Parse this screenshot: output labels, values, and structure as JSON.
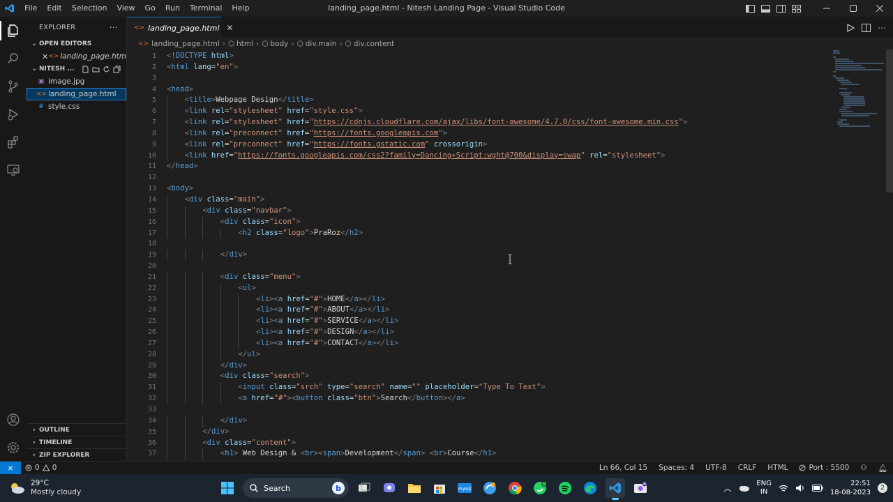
{
  "window": {
    "title": "landing_page.html - Nitesh Landing Page - Visual Studio Code",
    "menu": [
      "File",
      "Edit",
      "Selection",
      "View",
      "Go",
      "Run",
      "Terminal",
      "Help"
    ]
  },
  "sidebar": {
    "title": "EXPLORER",
    "open_editors_label": "OPEN EDITORS",
    "open_editor_file": "landing_page.html",
    "folder_label": "NITESH ...",
    "files": [
      "image.jpg",
      "landing_page.html",
      "style.css"
    ],
    "outline_label": "OUTLINE",
    "timeline_label": "TIMELINE",
    "zip_label": "ZIP EXPLORER"
  },
  "tab": {
    "label": "landing_page.html"
  },
  "breadcrumb": [
    "landing_page.html",
    "html",
    "body",
    "div.main",
    "div.content"
  ],
  "status": {
    "errors": "0",
    "warnings": "0",
    "position": "Ln 66, Col 15",
    "spaces": "Spaces: 4",
    "encoding": "UTF-8",
    "eol": "CRLF",
    "language": "HTML",
    "port": "Port : 5500"
  },
  "taskbar": {
    "temperature": "29°C",
    "condition": "Mostly cloudy",
    "search_label": "Search",
    "lang_top": "ENG",
    "lang_bottom": "IN",
    "time": "22:51",
    "date": "18-08-2023"
  },
  "colors": {
    "accent": "#0078d4",
    "tag": "#569cd6",
    "attr": "#9cdcfe",
    "string": "#ce9178"
  },
  "code": [
    {
      "indent": 0,
      "parts": [
        [
          "br",
          "<"
        ],
        [
          "tg",
          "!DOCTYPE "
        ],
        [
          "at",
          "html"
        ],
        [
          "br",
          ">"
        ]
      ]
    },
    {
      "indent": 0,
      "parts": [
        [
          "br",
          "<"
        ],
        [
          "tg",
          "html "
        ],
        [
          "at",
          "lang"
        ],
        [
          "tx",
          "="
        ],
        [
          "st",
          "\"en\""
        ],
        [
          "br",
          ">"
        ]
      ]
    },
    {
      "indent": 0,
      "parts": []
    },
    {
      "indent": 0,
      "parts": [
        [
          "br",
          "<"
        ],
        [
          "tg",
          "head"
        ],
        [
          "br",
          ">"
        ]
      ]
    },
    {
      "indent": 1,
      "parts": [
        [
          "br",
          "<"
        ],
        [
          "tg",
          "title"
        ],
        [
          "br",
          ">"
        ],
        [
          "tx",
          "Webpage Design"
        ],
        [
          "br",
          "</"
        ],
        [
          "tg",
          "title"
        ],
        [
          "br",
          ">"
        ]
      ]
    },
    {
      "indent": 1,
      "parts": [
        [
          "br",
          "<"
        ],
        [
          "tg",
          "link "
        ],
        [
          "at",
          "rel"
        ],
        [
          "tx",
          "="
        ],
        [
          "st",
          "\"stylesheet\" "
        ],
        [
          "at",
          "href"
        ],
        [
          "tx",
          "="
        ],
        [
          "st",
          "\"style.css\""
        ],
        [
          "br",
          ">"
        ]
      ]
    },
    {
      "indent": 1,
      "parts": [
        [
          "br",
          "<"
        ],
        [
          "tg",
          "link "
        ],
        [
          "at",
          "rel"
        ],
        [
          "tx",
          "="
        ],
        [
          "st",
          "\"stylesheet\" "
        ],
        [
          "at",
          "href"
        ],
        [
          "tx",
          "="
        ],
        [
          "st",
          "\""
        ],
        [
          "stl",
          "https://cdnjs.cloudflare.com/ajax/libs/font-awesome/4.7.0/css/font-awesome.min.css"
        ],
        [
          "st",
          "\""
        ],
        [
          "br",
          ">"
        ]
      ]
    },
    {
      "indent": 1,
      "parts": [
        [
          "br",
          "<"
        ],
        [
          "tg",
          "link "
        ],
        [
          "at",
          "rel"
        ],
        [
          "tx",
          "="
        ],
        [
          "st",
          "\"preconnect\" "
        ],
        [
          "at",
          "href"
        ],
        [
          "tx",
          "="
        ],
        [
          "st",
          "\""
        ],
        [
          "stl",
          "https://fonts.googleapis.com"
        ],
        [
          "st",
          "\""
        ],
        [
          "br",
          ">"
        ]
      ]
    },
    {
      "indent": 1,
      "parts": [
        [
          "br",
          "<"
        ],
        [
          "tg",
          "link "
        ],
        [
          "at",
          "rel"
        ],
        [
          "tx",
          "="
        ],
        [
          "st",
          "\"preconnect\" "
        ],
        [
          "at",
          "href"
        ],
        [
          "tx",
          "="
        ],
        [
          "st",
          "\""
        ],
        [
          "stl",
          "https://fonts.gstatic.com"
        ],
        [
          "st",
          "\" "
        ],
        [
          "at",
          "crossorigin"
        ],
        [
          "br",
          ">"
        ]
      ]
    },
    {
      "indent": 1,
      "parts": [
        [
          "br",
          "<"
        ],
        [
          "tg",
          "link "
        ],
        [
          "at",
          "href"
        ],
        [
          "tx",
          "="
        ],
        [
          "st",
          "\""
        ],
        [
          "stl",
          "https://fonts.googleapis.com/css2?family=Dancing+Script:wght@700&display=swap"
        ],
        [
          "st",
          "\" "
        ],
        [
          "at",
          "rel"
        ],
        [
          "tx",
          "="
        ],
        [
          "st",
          "\"stylesheet\""
        ],
        [
          "br",
          ">"
        ]
      ]
    },
    {
      "indent": 0,
      "parts": [
        [
          "br",
          "</"
        ],
        [
          "tg",
          "head"
        ],
        [
          "br",
          ">"
        ]
      ]
    },
    {
      "indent": 0,
      "parts": []
    },
    {
      "indent": 0,
      "parts": [
        [
          "br",
          "<"
        ],
        [
          "tg",
          "body"
        ],
        [
          "br",
          ">"
        ]
      ]
    },
    {
      "indent": 1,
      "parts": [
        [
          "br",
          "<"
        ],
        [
          "tg",
          "div "
        ],
        [
          "at",
          "class"
        ],
        [
          "tx",
          "="
        ],
        [
          "st",
          "\"main\""
        ],
        [
          "br",
          ">"
        ]
      ]
    },
    {
      "indent": 2,
      "parts": [
        [
          "br",
          "<"
        ],
        [
          "tg",
          "div "
        ],
        [
          "at",
          "class"
        ],
        [
          "tx",
          "="
        ],
        [
          "st",
          "\"navbar\""
        ],
        [
          "br",
          ">"
        ]
      ]
    },
    {
      "indent": 3,
      "parts": [
        [
          "br",
          "<"
        ],
        [
          "tg",
          "div "
        ],
        [
          "at",
          "class"
        ],
        [
          "tx",
          "="
        ],
        [
          "st",
          "\"icon\""
        ],
        [
          "br",
          ">"
        ]
      ]
    },
    {
      "indent": 4,
      "parts": [
        [
          "br",
          "<"
        ],
        [
          "tg",
          "h2 "
        ],
        [
          "at",
          "class"
        ],
        [
          "tx",
          "="
        ],
        [
          "st",
          "\"logo\""
        ],
        [
          "br",
          ">"
        ],
        [
          "tx",
          "PraRoz"
        ],
        [
          "br",
          "</"
        ],
        [
          "tg",
          "h2"
        ],
        [
          "br",
          ">"
        ]
      ]
    },
    {
      "indent": 0,
      "parts": []
    },
    {
      "indent": 3,
      "parts": [
        [
          "br",
          "</"
        ],
        [
          "tg",
          "div"
        ],
        [
          "br",
          ">"
        ]
      ]
    },
    {
      "indent": 0,
      "parts": []
    },
    {
      "indent": 3,
      "parts": [
        [
          "br",
          "<"
        ],
        [
          "tg",
          "div "
        ],
        [
          "at",
          "class"
        ],
        [
          "tx",
          "="
        ],
        [
          "st",
          "\"menu\""
        ],
        [
          "br",
          ">"
        ]
      ]
    },
    {
      "indent": 4,
      "parts": [
        [
          "br",
          "<"
        ],
        [
          "tg",
          "ul"
        ],
        [
          "br",
          ">"
        ]
      ]
    },
    {
      "indent": 5,
      "parts": [
        [
          "br",
          "<"
        ],
        [
          "tg",
          "li"
        ],
        [
          "br",
          "><"
        ],
        [
          "tg",
          "a "
        ],
        [
          "at",
          "href"
        ],
        [
          "tx",
          "="
        ],
        [
          "st",
          "\"#\""
        ],
        [
          "br",
          ">"
        ],
        [
          "tx",
          "HOME"
        ],
        [
          "br",
          "</"
        ],
        [
          "tg",
          "a"
        ],
        [
          "br",
          "></"
        ],
        [
          "tg",
          "li"
        ],
        [
          "br",
          ">"
        ]
      ]
    },
    {
      "indent": 5,
      "parts": [
        [
          "br",
          "<"
        ],
        [
          "tg",
          "li"
        ],
        [
          "br",
          "><"
        ],
        [
          "tg",
          "a "
        ],
        [
          "at",
          "href"
        ],
        [
          "tx",
          "="
        ],
        [
          "st",
          "\"#\""
        ],
        [
          "br",
          ">"
        ],
        [
          "tx",
          "ABOUT"
        ],
        [
          "br",
          "</"
        ],
        [
          "tg",
          "a"
        ],
        [
          "br",
          "></"
        ],
        [
          "tg",
          "li"
        ],
        [
          "br",
          ">"
        ]
      ]
    },
    {
      "indent": 5,
      "parts": [
        [
          "br",
          "<"
        ],
        [
          "tg",
          "li"
        ],
        [
          "br",
          "><"
        ],
        [
          "tg",
          "a "
        ],
        [
          "at",
          "href"
        ],
        [
          "tx",
          "="
        ],
        [
          "st",
          "\"#\""
        ],
        [
          "br",
          ">"
        ],
        [
          "tx",
          "SERVICE"
        ],
        [
          "br",
          "</"
        ],
        [
          "tg",
          "a"
        ],
        [
          "br",
          "></"
        ],
        [
          "tg",
          "li"
        ],
        [
          "br",
          ">"
        ]
      ]
    },
    {
      "indent": 5,
      "parts": [
        [
          "br",
          "<"
        ],
        [
          "tg",
          "li"
        ],
        [
          "br",
          "><"
        ],
        [
          "tg",
          "a "
        ],
        [
          "at",
          "href"
        ],
        [
          "tx",
          "="
        ],
        [
          "st",
          "\"#\""
        ],
        [
          "br",
          ">"
        ],
        [
          "tx",
          "DESIGN"
        ],
        [
          "br",
          "</"
        ],
        [
          "tg",
          "a"
        ],
        [
          "br",
          "></"
        ],
        [
          "tg",
          "li"
        ],
        [
          "br",
          ">"
        ]
      ]
    },
    {
      "indent": 5,
      "parts": [
        [
          "br",
          "<"
        ],
        [
          "tg",
          "li"
        ],
        [
          "br",
          "><"
        ],
        [
          "tg",
          "a "
        ],
        [
          "at",
          "href"
        ],
        [
          "tx",
          "="
        ],
        [
          "st",
          "\"#\""
        ],
        [
          "br",
          ">"
        ],
        [
          "tx",
          "CONTACT"
        ],
        [
          "br",
          "</"
        ],
        [
          "tg",
          "a"
        ],
        [
          "br",
          "></"
        ],
        [
          "tg",
          "li"
        ],
        [
          "br",
          ">"
        ]
      ]
    },
    {
      "indent": 4,
      "parts": [
        [
          "br",
          "</"
        ],
        [
          "tg",
          "ul"
        ],
        [
          "br",
          ">"
        ]
      ]
    },
    {
      "indent": 3,
      "parts": [
        [
          "br",
          "</"
        ],
        [
          "tg",
          "div"
        ],
        [
          "br",
          ">"
        ]
      ]
    },
    {
      "indent": 3,
      "parts": [
        [
          "br",
          "<"
        ],
        [
          "tg",
          "div "
        ],
        [
          "at",
          "class"
        ],
        [
          "tx",
          "="
        ],
        [
          "st",
          "\"search\""
        ],
        [
          "br",
          ">"
        ]
      ]
    },
    {
      "indent": 4,
      "parts": [
        [
          "br",
          "<"
        ],
        [
          "tg",
          "input "
        ],
        [
          "at",
          "class"
        ],
        [
          "tx",
          "="
        ],
        [
          "st",
          "\"srch\" "
        ],
        [
          "at",
          "type"
        ],
        [
          "tx",
          "="
        ],
        [
          "st",
          "\"search\" "
        ],
        [
          "at",
          "name"
        ],
        [
          "tx",
          "="
        ],
        [
          "st",
          "\"\" "
        ],
        [
          "at",
          "placeholder"
        ],
        [
          "tx",
          "="
        ],
        [
          "st",
          "\"Type To Text\""
        ],
        [
          "br",
          ">"
        ]
      ]
    },
    {
      "indent": 4,
      "parts": [
        [
          "br",
          "<"
        ],
        [
          "tg",
          "a "
        ],
        [
          "at",
          "href"
        ],
        [
          "tx",
          "="
        ],
        [
          "st",
          "\"#\""
        ],
        [
          "br",
          "><"
        ],
        [
          "tg",
          "button "
        ],
        [
          "at",
          "class"
        ],
        [
          "tx",
          "="
        ],
        [
          "st",
          "\"btn\""
        ],
        [
          "br",
          ">"
        ],
        [
          "tx",
          "Search"
        ],
        [
          "br",
          "</"
        ],
        [
          "tg",
          "button"
        ],
        [
          "br",
          "></"
        ],
        [
          "tg",
          "a"
        ],
        [
          "br",
          ">"
        ]
      ]
    },
    {
      "indent": 0,
      "parts": []
    },
    {
      "indent": 3,
      "parts": [
        [
          "br",
          "</"
        ],
        [
          "tg",
          "div"
        ],
        [
          "br",
          ">"
        ]
      ]
    },
    {
      "indent": 2,
      "parts": [
        [
          "br",
          "</"
        ],
        [
          "tg",
          "div"
        ],
        [
          "br",
          ">"
        ]
      ]
    },
    {
      "indent": 2,
      "parts": [
        [
          "br",
          "<"
        ],
        [
          "tg",
          "div "
        ],
        [
          "at",
          "class"
        ],
        [
          "tx",
          "="
        ],
        [
          "st",
          "\"content\""
        ],
        [
          "br",
          ">"
        ]
      ]
    },
    {
      "indent": 3,
      "parts": [
        [
          "br",
          "<"
        ],
        [
          "tg",
          "h1"
        ],
        [
          "br",
          ">"
        ],
        [
          "tx",
          " Web Design & "
        ],
        [
          "br",
          "<"
        ],
        [
          "tg",
          "br"
        ],
        [
          "br",
          "><"
        ],
        [
          "tg",
          "span"
        ],
        [
          "br",
          ">"
        ],
        [
          "tx",
          "Development"
        ],
        [
          "br",
          "</"
        ],
        [
          "tg",
          "span"
        ],
        [
          "br",
          "> <"
        ],
        [
          "tg",
          "br"
        ],
        [
          "br",
          ">"
        ],
        [
          "tx",
          "Course"
        ],
        [
          "br",
          "</"
        ],
        [
          "tg",
          "h1"
        ],
        [
          "br",
          ">"
        ]
      ]
    }
  ]
}
